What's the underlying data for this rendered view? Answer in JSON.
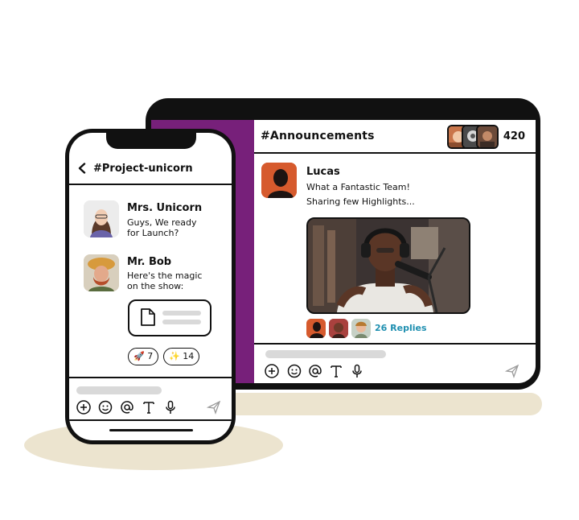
{
  "desktop": {
    "channel_title": "#Announcements",
    "member_count": "420",
    "message": {
      "author": "Lucas",
      "lines": [
        "What a Fantastic Team!",
        "Sharing few Highlights..."
      ],
      "replies_label": "26 Replies"
    }
  },
  "phone": {
    "channel_title": "#Project-unicorn",
    "messages": [
      {
        "author": "Mrs. Unicorn",
        "lines": [
          "Guys, We ready",
          "for Launch?"
        ]
      },
      {
        "author": "Mr. Bob",
        "lines": [
          "Here's the magic",
          "on the show:"
        ]
      }
    ],
    "reactions": [
      {
        "emoji": "🚀",
        "count": "7"
      },
      {
        "emoji": "✨",
        "count": "14"
      }
    ]
  },
  "colors": {
    "sidebar": "#77207a",
    "reply_link": "#1e8fb0",
    "ground_shadow": "#ece4cf"
  },
  "icons": [
    "back-chevron-icon",
    "plus-circle-icon",
    "emoji-icon",
    "mention-icon",
    "text-format-icon",
    "microphone-icon",
    "send-icon",
    "document-icon"
  ]
}
